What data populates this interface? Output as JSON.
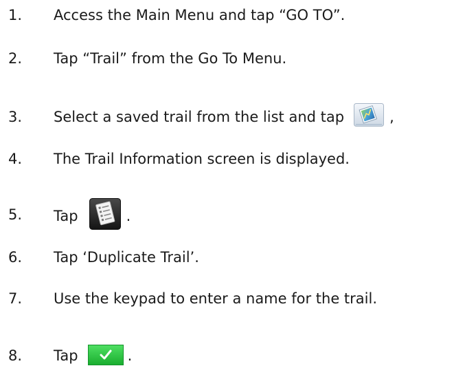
{
  "steps": [
    {
      "num": "1.",
      "text": "Access the Main Menu and tap “GO TO”."
    },
    {
      "num": "2.",
      "text": "Tap “Trail” from the Go To Menu."
    },
    {
      "num": "3.",
      "text": "Select a saved trail from the list and tap",
      "after": ","
    },
    {
      "num": "4.",
      "text": "The Trail Information screen is displayed."
    },
    {
      "num": "5.",
      "text": "Tap",
      "after": "."
    },
    {
      "num": "6.",
      "text": "Tap ‘Duplicate Trail’."
    },
    {
      "num": "7.",
      "text": "Use the keypad to enter a name for the trail."
    },
    {
      "num": "8.",
      "text": "Tap",
      "after": "."
    }
  ],
  "icons": {
    "step3": "trail-map-icon",
    "step5": "options-list-icon",
    "step8": "green-checkmark-icon"
  },
  "colors": {
    "text": "#1a1a1a",
    "check_green": "#22c63a",
    "list_icon_bg": "#2b2b2b"
  }
}
